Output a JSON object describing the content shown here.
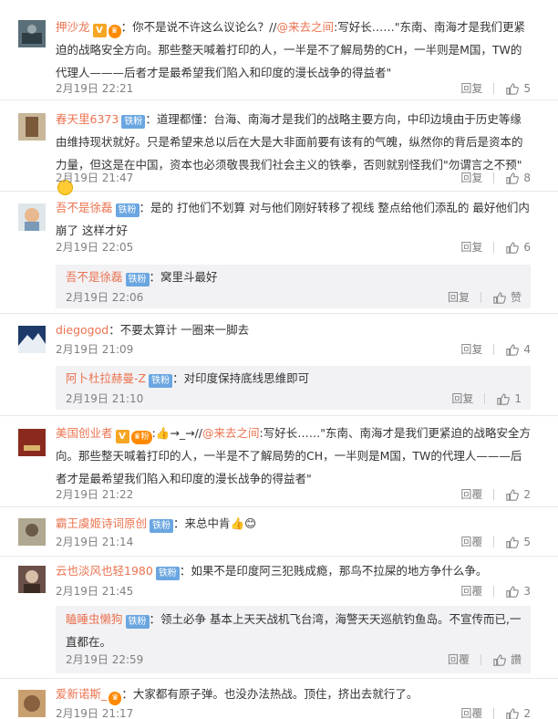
{
  "badges": {
    "vip": "V",
    "fan": "铁粉",
    "fan_short": "粉",
    "crown": "♛"
  },
  "reply_label": "回复",
  "colors": {
    "username": "#eb7350",
    "fan_badge": "#6aa6e0",
    "vip_badge": "#f5a623",
    "sub_bg": "#f2f2f5"
  },
  "comments": [
    {
      "user": "押沙龙",
      "prefix": "：你不是说不许这么议论么？//",
      "mention": "@来去之间",
      "text": ":写好长……\"东南、南海才是我们更紧迫的战略安全方向。那些整天喊着打印的人，一半是不了解局势的CH，一半则是M国，TW的代理人———后者才是最希望我们陷入和印度的漫长战争的得益者\"",
      "time": "2月19日 22:21",
      "reply": "回复",
      "likes": "5"
    },
    {
      "user": "春天里6373",
      "text": "：道理都懂：台海、南海才是我们的战略主要方向，中印边境由于历史等缘由维持现状就好。只是希望来总以后在大是大非面前要有该有的气魄，纵然你的背后是资本的力量，但这是在中国，资本也必须敬畏我们社会主义的铁拳，否则就别怪我们\"勿谓言之不预\"",
      "time": "2月19日 21:47",
      "reply": "回复",
      "likes": "8"
    },
    {
      "user": "吾不是徐磊",
      "text": "：是的 打他们不划算 对与他们刚好转移了视线 整点给他们添乱的 最好他们内崩了 这样才好",
      "time": "2月19日 22:05",
      "reply": "回复",
      "likes": "6"
    },
    {
      "sub": true,
      "user": "吾不是徐磊",
      "text": "：窝里斗最好",
      "time": "2月19日 22:06",
      "reply": "回复",
      "likes": "赞"
    },
    {
      "user": "diegogod",
      "text": "：不要太算计 一圈来一脚去",
      "time": "2月19日 21:09",
      "reply": "回复",
      "likes": "4"
    },
    {
      "sub": true,
      "user": "阿卜杜拉赫曼-Z",
      "text": "：对印度保持底线思维即可",
      "time": "2月19日 21:10",
      "reply": "回复",
      "likes": "1"
    },
    {
      "user": "美国创业者",
      "prefix": ":👍→_→//",
      "mention": "@来去之间",
      "text": ":写好长……\"东南、南海才是我们更紧迫的战略安全方向。那些整天喊着打印的人，一半是不了解局势的CH，一半则是M国，TW的代理人———后者才是最希望我们陷入和印度的漫长战争的得益者\"",
      "time": "2月19日 21:22",
      "reply": "回覆",
      "likes": "2"
    },
    {
      "user": "霸王虞姬诗词原创",
      "text": "：来总中肯👍😊",
      "time": "2月19日 21:14",
      "reply": "回覆",
      "likes": "5"
    },
    {
      "user": "云也淡风也轻1980",
      "text": "：如果不是印度阿三犯贱成瘾，那鸟不拉屎的地方争什么争。",
      "time": "2月19日 21:45",
      "reply": "回覆",
      "likes": "3"
    },
    {
      "sub": true,
      "user": "瞌睡虫懒狗",
      "text": "：领土必争 基本上天天战机飞台湾，海警天天巡航钓鱼岛。不宣传而已,一直都在。",
      "time": "2月19日 22:59",
      "reply": "回覆",
      "likes": "讚"
    },
    {
      "user": "爱新诺斯_",
      "text": "：大家都有原子弹。也没办法热战。顶住，挤出去就行了。",
      "time": "2月19日 21:17",
      "reply": "回覆",
      "likes": "2"
    }
  ]
}
